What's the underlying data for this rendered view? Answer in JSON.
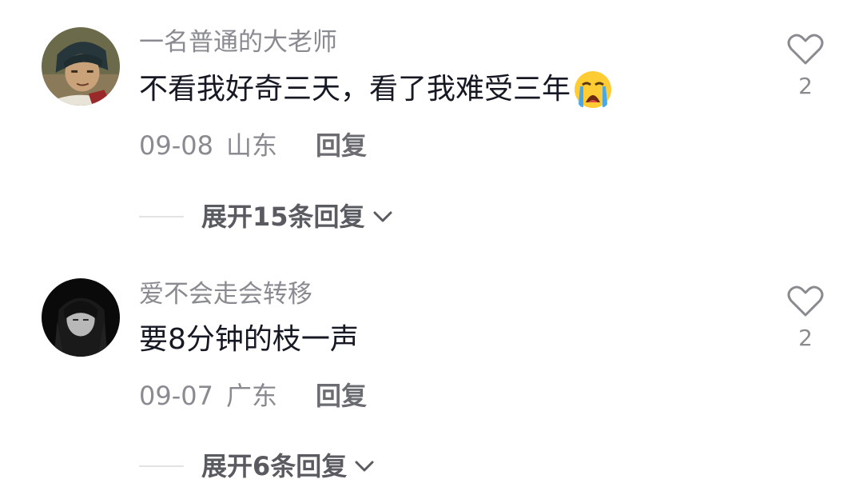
{
  "comments": [
    {
      "username": "一名普通的大老师",
      "text": "不看我好奇三天，看了我难受三年",
      "emoji": "loudly-crying-face",
      "date": "09-08",
      "region": "山东",
      "reply_label": "回复",
      "likes": "2",
      "expand_label": "展开15条回复"
    },
    {
      "username": "爱不会走会转移",
      "text": "要8分钟的枝一声",
      "date": "09-07",
      "region": "广东",
      "reply_label": "回复",
      "likes": "2",
      "expand_label": "展开6条回复"
    }
  ],
  "colors": {
    "primary_text": "#161823",
    "secondary_text": "#8a8b91",
    "background": "#ffffff"
  },
  "icons": [
    "heart-outline-icon",
    "chevron-down-icon"
  ]
}
